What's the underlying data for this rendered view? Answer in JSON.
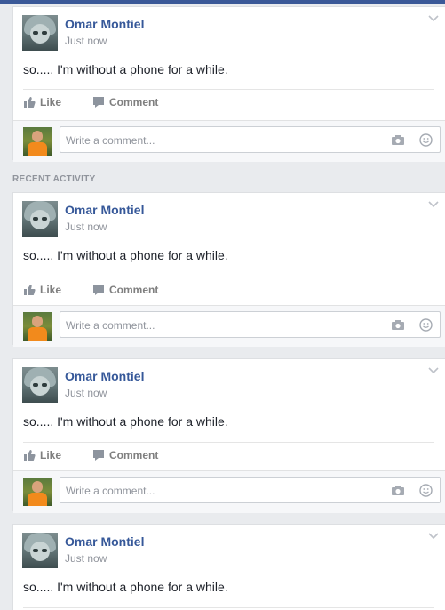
{
  "section_label": "RECENT ACTIVITY",
  "posts": [
    {
      "author": "Omar Montiel",
      "time": "Just now",
      "text": "so..... I'm without a phone for a while.",
      "like_label": "Like",
      "comment_label": "Comment",
      "comment_placeholder": "Write a comment..."
    },
    {
      "author": "Omar Montiel",
      "time": "Just now",
      "text": "so..... I'm without a phone for a while.",
      "like_label": "Like",
      "comment_label": "Comment",
      "comment_placeholder": "Write a comment..."
    },
    {
      "author": "Omar Montiel",
      "time": "Just now",
      "text": "so..... I'm without a phone for a while.",
      "like_label": "Like",
      "comment_label": "Comment",
      "comment_placeholder": "Write a comment..."
    },
    {
      "author": "Omar Montiel",
      "time": "Just now",
      "text": "so..... I'm without a phone for a while."
    }
  ],
  "colors": {
    "author_link": "#365899",
    "feed_background": "#e9ebee",
    "top_bar": "#3b5998"
  },
  "icons": [
    "chevron-down-icon",
    "like-thumb-icon",
    "comment-bubble-icon",
    "camera-icon",
    "smiley-icon"
  ]
}
